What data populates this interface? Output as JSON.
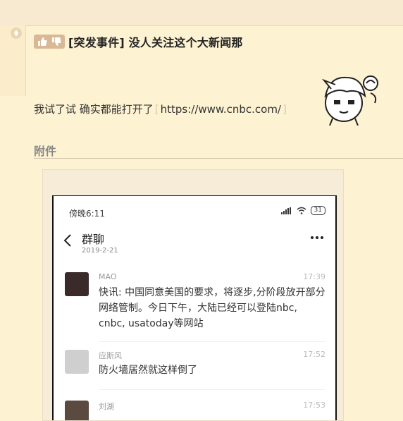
{
  "post": {
    "title": "[突发事件] 没人关注这个大新闻那",
    "body_text": "我试了试 确实都能打开了",
    "link_open_bracket": "[",
    "link_url": "https://www.cnbc.com/",
    "link_close_bracket": "]"
  },
  "attachments": {
    "label": "附件"
  },
  "screenshot": {
    "status_time": "傍晚6:11",
    "battery": "31",
    "chat_title": "群聊",
    "chat_date": "2019-2-21",
    "messages": [
      {
        "name": "MAO",
        "time": "17:39",
        "text": "快讯: 中国同意美国的要求，将逐步,分阶段放开部分网络管制。今日下午，大陆已经可以登陆nbc, cnbc, usatoday等网站"
      },
      {
        "name": "应斯风",
        "time": "17:52",
        "text": "防火墙居然就这样倒了"
      },
      {
        "name": "刘湖",
        "time": "17:53",
        "text": ""
      }
    ]
  },
  "colors": {
    "page_bg": "#fdf2d2",
    "vote_bg": "#d9b896",
    "bracket": "#d9c9a0"
  }
}
